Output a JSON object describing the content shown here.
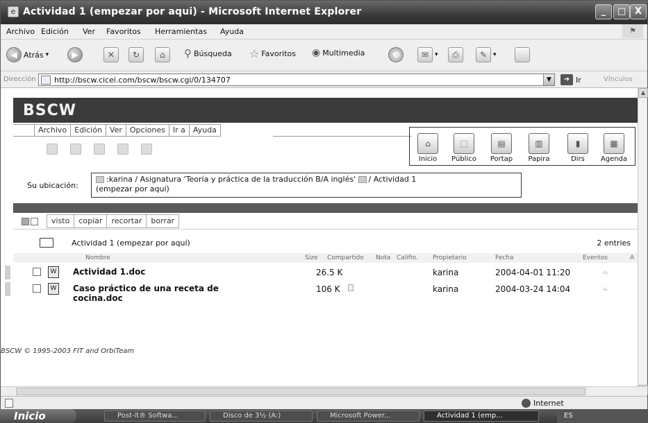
{
  "window": {
    "title": "Actividad 1 (empezar por aqui) - Microsoft Internet Explorer",
    "min": "_",
    "max": "□",
    "close": "X"
  },
  "menubar": [
    "Archivo",
    "Edición",
    "Ver",
    "Favoritos",
    "Herramientas",
    "Ayuda"
  ],
  "toolbar": {
    "back": "Atrás",
    "search": "Búsqueda",
    "favorites": "Favoritos",
    "media": "Multimedia"
  },
  "address": {
    "label": "Dirección",
    "url": "http://bscw.cicei.com/bscw/bscw.cgi/0/134707",
    "go": "Ir",
    "links": "Vínculos"
  },
  "bscw": {
    "logo": "BSCW",
    "menu": [
      "Archivo",
      "Edición",
      "Ver",
      "Opciones",
      "Ir a",
      "Ayuda"
    ],
    "nav": [
      "Inicio",
      "Público",
      "Portap",
      "Papira",
      "Dirs",
      "Agenda"
    ],
    "location_label": "Su ubicación:",
    "location_path_1": ":karina / Asignatura 'Teoría y práctica de la traducción B/A inglés'",
    "location_path_2": "/ Actividad 1",
    "location_path_3": "(empezar por aquí)",
    "actions": [
      "visto",
      "copiar",
      "recortar",
      "borrar"
    ],
    "folder_name": "Actividad 1 (empezar por aquí)",
    "entries": "2 entries",
    "columns": {
      "name": "Nombre",
      "size": "Size",
      "shared": "Compartido",
      "note": "Nota",
      "rating": "Califio.",
      "owner": "Propietario",
      "date": "Fecha",
      "events": "Eventos",
      "extra": "A"
    },
    "rows": [
      {
        "name_1": "Actividad 1.doc",
        "name_2": "",
        "size": "26.5 K",
        "owner": "karina",
        "date": "2004-04-01 11:20",
        "events": "⌯"
      },
      {
        "name_1": "Caso práctico de una receta de",
        "name_2": "cocina.doc",
        "size": "106 K",
        "owner": "karina",
        "date": "2004-03-24 14:04",
        "events": "⌯"
      }
    ],
    "footer": "BSCW © 1995-2003 FIT and OrbiTeam"
  },
  "status": {
    "zone": "Internet"
  },
  "taskbar": {
    "start": "Inicio",
    "tasks": [
      "Post-it® Softwa...",
      "Disco de 3½ (A:)",
      "Microsoft Power...",
      "Actividad 1 (emp..."
    ],
    "tray": "ES"
  }
}
